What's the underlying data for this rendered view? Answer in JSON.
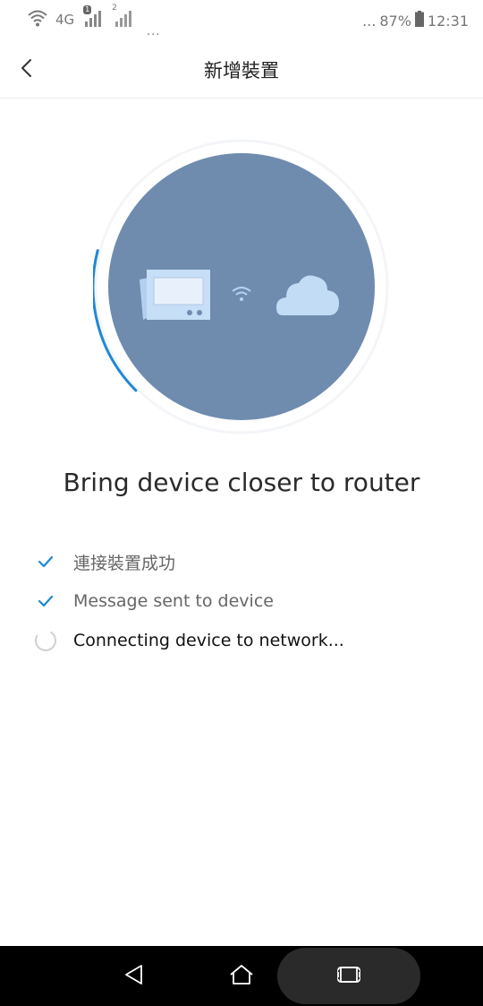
{
  "status_bar": {
    "network": "4G",
    "sim1_badge": "1",
    "sim2_label": "2",
    "overflow": "...",
    "battery_dots": "...",
    "battery_percent": "87%",
    "time": "12:31",
    "icons": [
      "wifi-icon",
      "signal-icon",
      "battery-icon"
    ]
  },
  "header": {
    "title": "新增裝置",
    "back_icon": "chevron-left-icon"
  },
  "illustration": {
    "circle_color": "#6f8caf",
    "progress_color": "#1e88d6",
    "device_icon": "tablet-icon",
    "connection_icon": "wifi-icon",
    "target_icon": "cloud-icon"
  },
  "headline": "Bring device closer to router",
  "steps": [
    {
      "label": "連接裝置成功",
      "status": "done",
      "icon": "check-icon"
    },
    {
      "label": "Message sent to device",
      "status": "done",
      "icon": "check-icon"
    },
    {
      "label": "Connecting device to network...",
      "status": "in_progress",
      "icon": "spinner-icon"
    }
  ],
  "nav_bar": {
    "icons": [
      "back-triangle-icon",
      "home-icon",
      "recent-apps-icon"
    ]
  },
  "colors": {
    "accent": "#1e88d6",
    "circle": "#6f8caf",
    "navbar": "#000000"
  }
}
